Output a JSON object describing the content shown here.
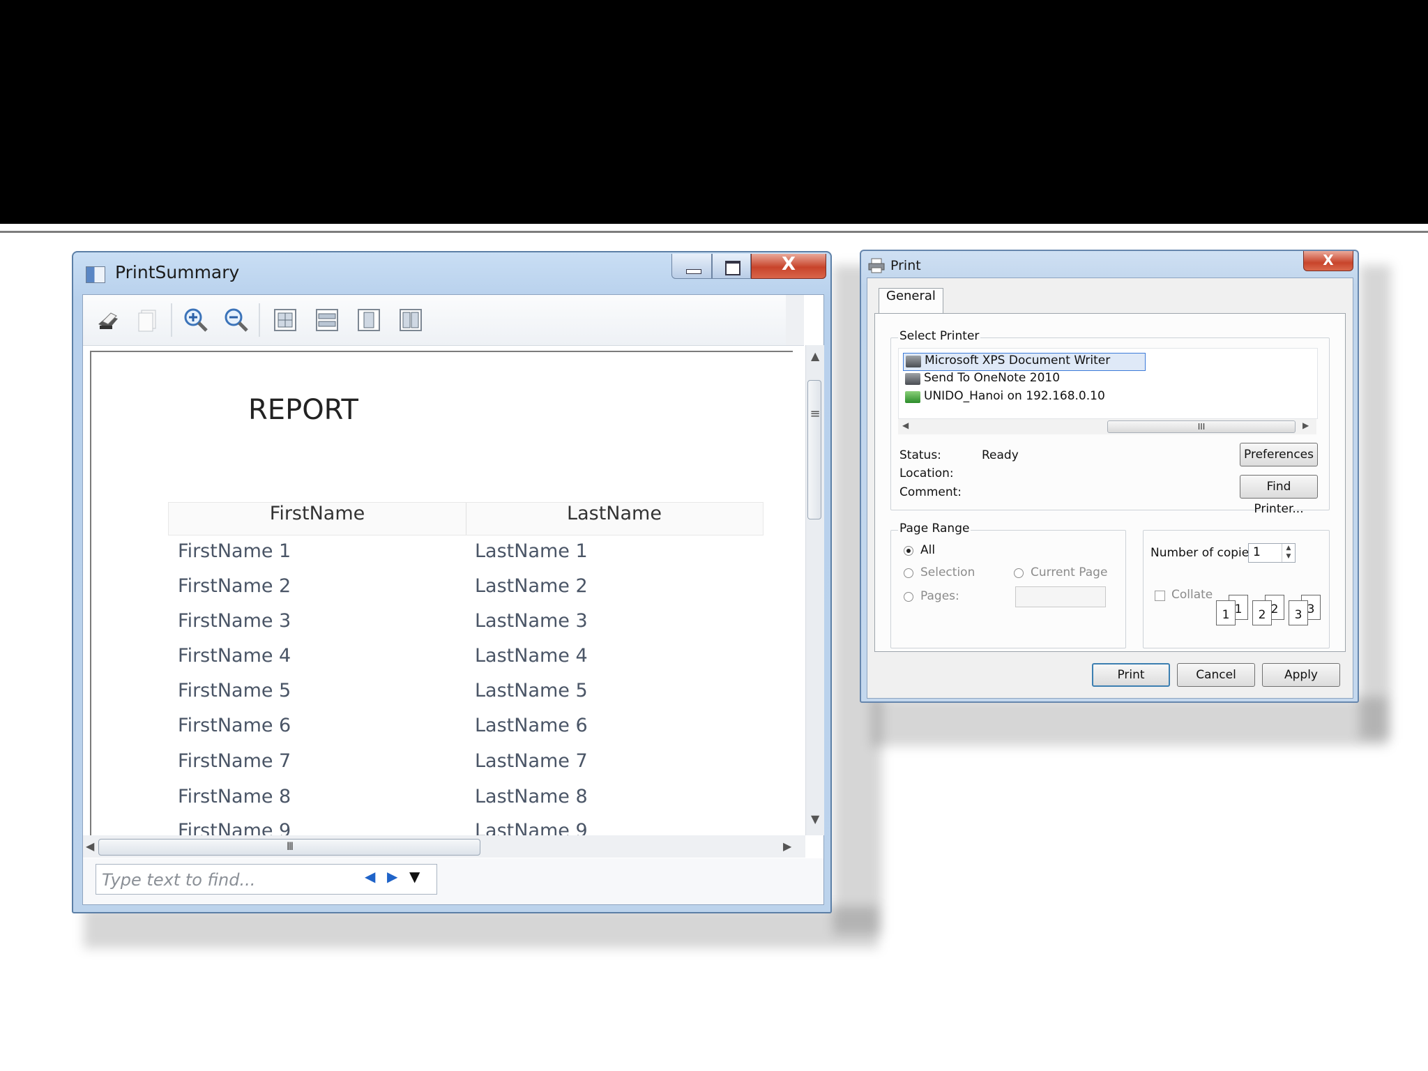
{
  "window_print_summary": {
    "title": "PrintSummary",
    "report_title": "REPORT",
    "columns": [
      "FirstName",
      "LastName"
    ],
    "rows": [
      [
        "FirstName 1",
        "LastName 1"
      ],
      [
        "FirstName 2",
        "LastName 2"
      ],
      [
        "FirstName 3",
        "LastName 3"
      ],
      [
        "FirstName 4",
        "LastName 4"
      ],
      [
        "FirstName 5",
        "LastName 5"
      ],
      [
        "FirstName 6",
        "LastName 6"
      ],
      [
        "FirstName 7",
        "LastName 7"
      ],
      [
        "FirstName 8",
        "LastName 8"
      ],
      [
        "FirstName 9",
        "LastName 9"
      ]
    ],
    "toolbar_icons": [
      "print-icon",
      "copy-icon",
      "zoom-in-icon",
      "zoom-out-icon",
      "actual-size-icon",
      "page-width-icon",
      "whole-page-icon",
      "two-pages-icon"
    ],
    "find_placeholder": "Type text to find...",
    "scroll_grip": "III",
    "caption_glyphs": {
      "close": "X"
    }
  },
  "window_print": {
    "title": "Print",
    "tab_label": "General",
    "select_printer_label": "Select Printer",
    "printers": [
      "Microsoft XPS Document Writer",
      "Send To OneNote 2010",
      "UNIDO_Hanoi on 192.168.0.10"
    ],
    "selected_printer_index": 0,
    "scroll_grip": "III",
    "status_label": "Status:",
    "status_value": "Ready",
    "location_label": "Location:",
    "comment_label": "Comment:",
    "preferences_button": "Preferences",
    "find_printer_button": "Find Printer...",
    "page_range_label": "Page Range",
    "range_options": {
      "all": "All",
      "selection": "Selection",
      "current_page": "Current Page",
      "pages": "Pages:"
    },
    "copies_label": "Number of copies:",
    "copies_value": "1",
    "collate_label": "Collate",
    "collate_pages": [
      "1",
      "1",
      "2",
      "2",
      "3",
      "3"
    ],
    "buttons": {
      "print": "Print",
      "cancel": "Cancel",
      "apply": "Apply"
    },
    "close_glyph": "X"
  }
}
